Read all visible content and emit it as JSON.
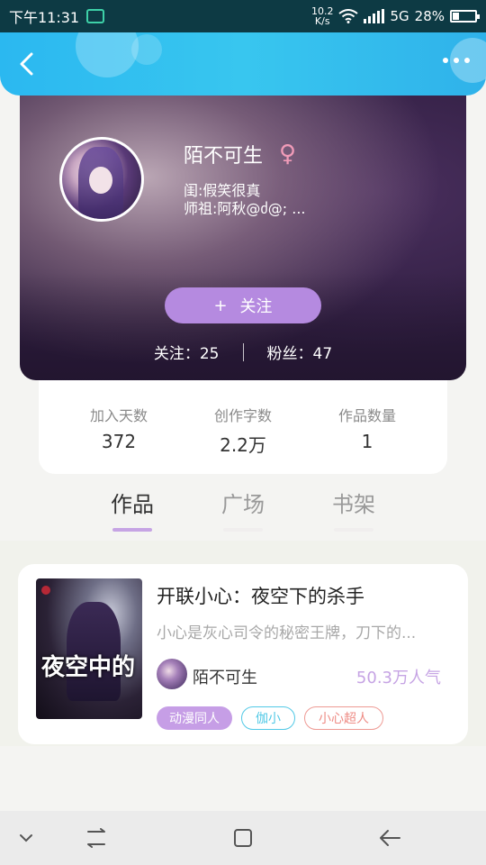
{
  "status_bar": {
    "time": "下午11:31",
    "net_speed_value": "10.2",
    "net_speed_unit": "K/s",
    "network": "5G",
    "battery": "28%"
  },
  "header": {
    "back_icon": "chevron-left-icon",
    "more_icon": "more-horizontal-icon",
    "color": "#2fb8ef"
  },
  "profile": {
    "name": "陌不可生",
    "gender_symbol": "♀",
    "bio_line1": "闺:假笑很真",
    "bio_line2": "师祖:阿秋@ძ@; ...",
    "follow_button": "关注",
    "follow_icon": "+",
    "following_label": "关注：",
    "following_count": "25",
    "fans_label": "粉丝：",
    "fans_count": "47",
    "accent": "#b58ae0"
  },
  "stats": [
    {
      "label": "加入天数",
      "value": "372"
    },
    {
      "label": "创作字数",
      "value": "2.2万"
    },
    {
      "label": "作品数量",
      "value": "1"
    }
  ],
  "tabs": [
    {
      "label": "作品",
      "active": true
    },
    {
      "label": "广场",
      "active": false
    },
    {
      "label": "书架",
      "active": false
    }
  ],
  "book": {
    "title": "开联小心：夜空下的杀手",
    "description": "小心是灰心司令的秘密王牌，刀下的...",
    "cover_text": "夜空中的",
    "author": "陌不可生",
    "popularity": "50.3万人气",
    "tags": [
      "动漫同人",
      "伽小",
      "小心超人"
    ]
  },
  "nav_bar": {
    "down_icon": "chevron-down-icon",
    "recents_icon": "recents-icon",
    "home_icon": "home-square-icon",
    "back_icon": "arrow-left-icon"
  }
}
